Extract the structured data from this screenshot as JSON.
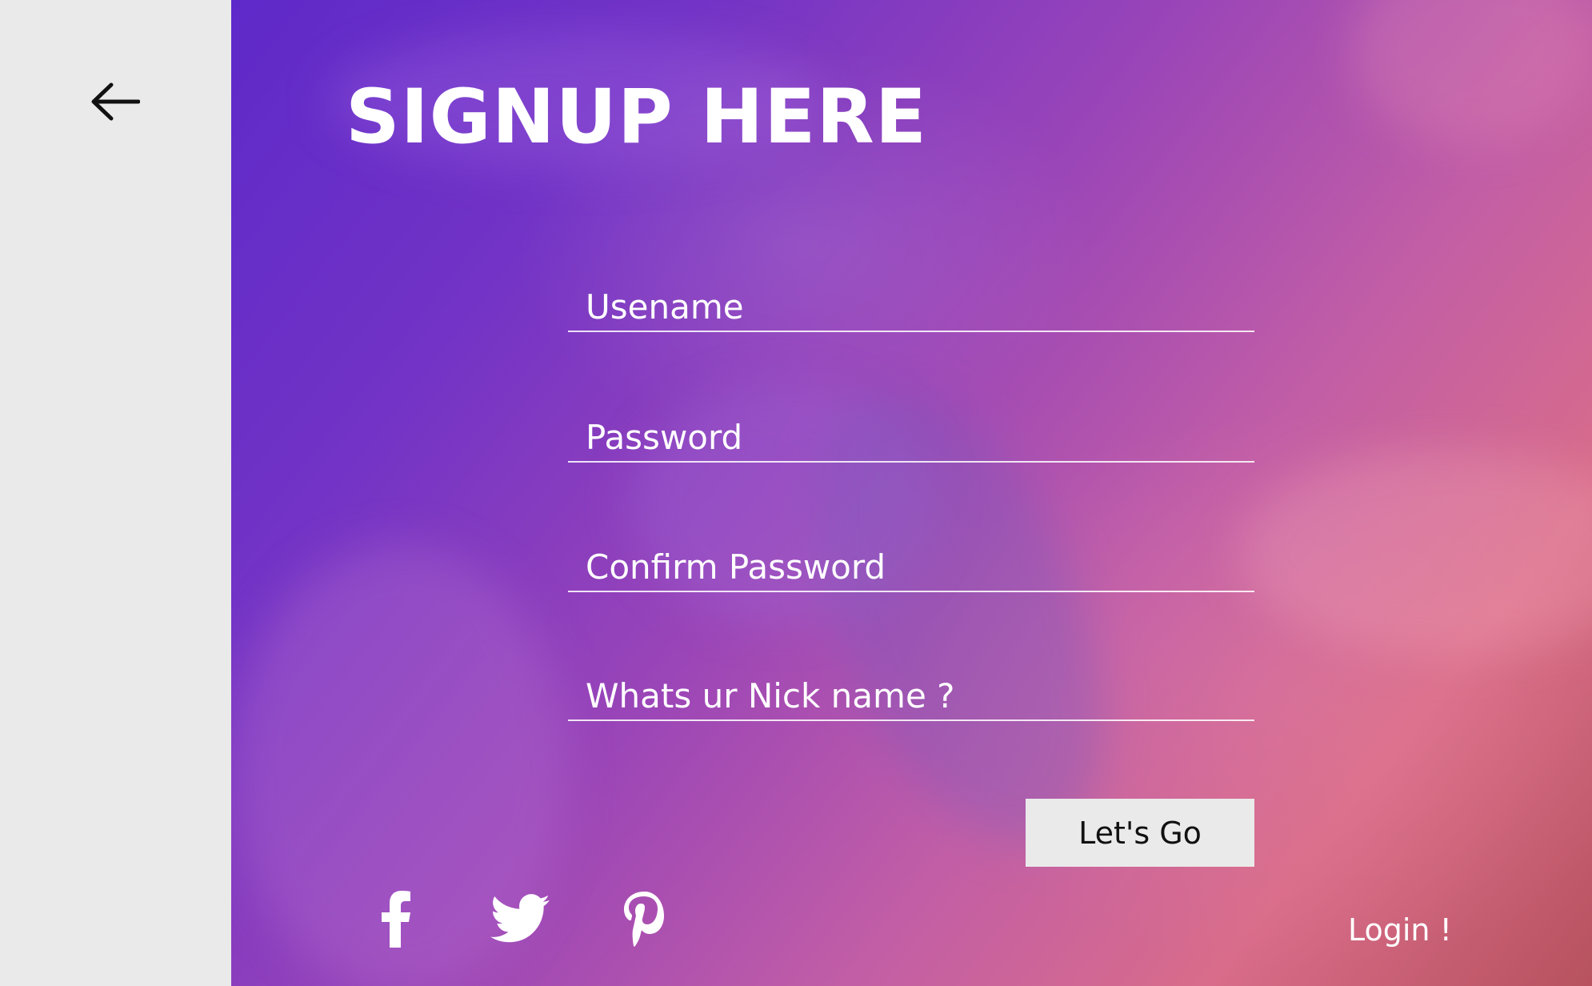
{
  "back": {
    "icon": "arrow-left-icon"
  },
  "signup": {
    "title": "SIGNUP HERE",
    "fields": [
      {
        "placeholder": "Usename",
        "value": ""
      },
      {
        "placeholder": "Password",
        "value": ""
      },
      {
        "placeholder": "Confirm Password",
        "value": ""
      },
      {
        "placeholder": "Whats ur Nick name ?",
        "value": ""
      }
    ],
    "submit_label": "Let's Go",
    "login_label": "Login !"
  },
  "social": [
    {
      "icon": "facebook-icon"
    },
    {
      "icon": "twitter-icon"
    },
    {
      "icon": "pinterest-icon"
    }
  ],
  "colors": {
    "sidebar_bg": "#eaeaea",
    "gradient_start": "#5e29c9",
    "gradient_end": "#d86c8a",
    "text": "#ffffff",
    "button_bg": "#eaeaea"
  }
}
